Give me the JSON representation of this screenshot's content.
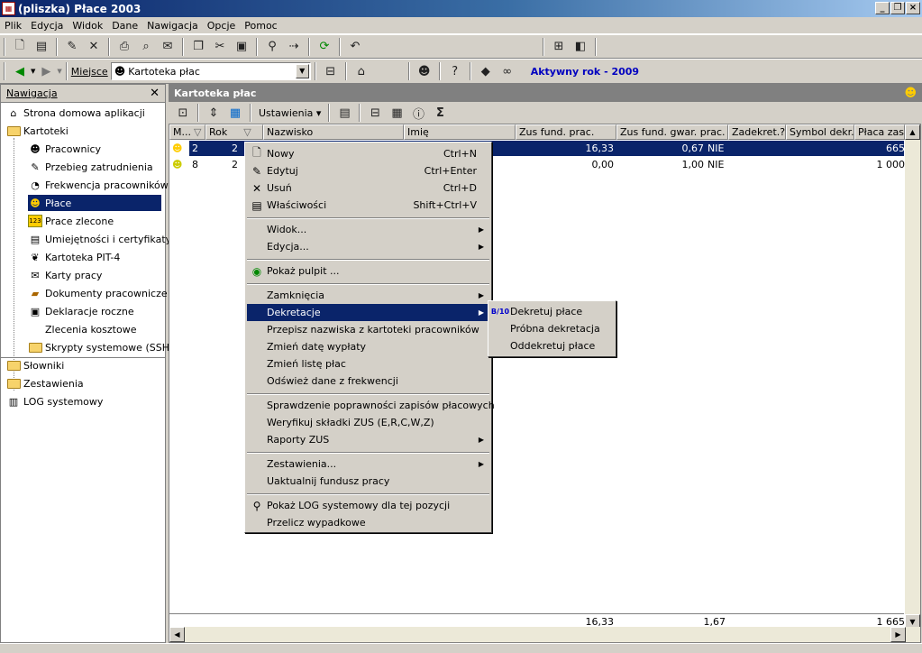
{
  "window": {
    "title": "(pliszka)  Płace 2003"
  },
  "menu": [
    "Plik",
    "Edycja",
    "Widok",
    "Dane",
    "Nawigacja",
    "Opcje",
    "Pomoc"
  ],
  "location": {
    "label": "Miejsce",
    "value": "Kartoteka płac",
    "active_year": "Aktywny rok - 2009"
  },
  "nav": {
    "title": "Nawigacja",
    "items": [
      {
        "label": "Strona domowa aplikacji",
        "icon": "home-icon"
      },
      {
        "label": "Kartoteki",
        "icon": "folder-open-icon"
      },
      {
        "label": "Pracownicy",
        "icon": "people-icon"
      },
      {
        "label": "Przebieg zatrudnienia",
        "icon": "history-icon"
      },
      {
        "label": "Frekwencja pracowników",
        "icon": "attendance-icon"
      },
      {
        "label": "Płace",
        "icon": "payroll-icon"
      },
      {
        "label": "Prace zlecone",
        "icon": "counter-icon"
      },
      {
        "label": "Umiejętności i certyfikaty",
        "icon": "certificate-icon"
      },
      {
        "label": "Kartoteka PIT-4",
        "icon": "tax-icon"
      },
      {
        "label": "Karty pracy",
        "icon": "card-icon"
      },
      {
        "label": "Dokumenty pracownicze",
        "icon": "documents-icon"
      },
      {
        "label": "Deklaracje roczne",
        "icon": "declaration-icon"
      },
      {
        "label": "Zlecenia kosztowe",
        "icon": ""
      },
      {
        "label": "Skrypty systemowe (SSH)",
        "icon": "folder-icon"
      },
      {
        "label": "Słowniki",
        "icon": "folder-icon"
      },
      {
        "label": "Zestawienia",
        "icon": "folder-icon"
      },
      {
        "label": "LOG systemowy",
        "icon": "log-icon"
      }
    ]
  },
  "main": {
    "title": "Kartoteka płac",
    "settings_label": "Ustawienia",
    "sigma": "Σ",
    "columns": [
      "M...",
      "Rok",
      "Nazwisko",
      "Imię",
      "Zus fund. prac.",
      "Zus fund. gwar. prac.",
      "Zadekret.?",
      "Symbol dekr...",
      "Płaca zasa"
    ],
    "rows": [
      {
        "m": "2",
        "rok": "2",
        "zus_prac": "16,33",
        "zus_gwar": "0,67",
        "zadekret": "NIE",
        "placa": "665"
      },
      {
        "m": "8",
        "rok": "2",
        "zus_prac": "0,00",
        "zus_gwar": "1,00",
        "zadekret": "NIE",
        "placa": "1 000"
      }
    ],
    "totals": {
      "zus_prac": "16,33",
      "zus_gwar": "1,67",
      "placa": "1 665"
    }
  },
  "context_menu": [
    {
      "label": "Nowy",
      "shortcut": "Ctrl+N",
      "icon": "new-icon"
    },
    {
      "label": "Edytuj",
      "shortcut": "Ctrl+Enter",
      "icon": "edit-icon"
    },
    {
      "label": "Usuń",
      "shortcut": "Ctrl+D",
      "icon": "delete-icon"
    },
    {
      "label": "Właściwości",
      "shortcut": "Shift+Ctrl+V",
      "icon": "properties-icon"
    },
    {
      "label": "Widok...",
      "submenu": true
    },
    {
      "label": "Edycja...",
      "submenu": true
    },
    {
      "label": "Pokaż pulpit ...",
      "icon": "desktop-icon"
    },
    {
      "label": "Zamknięcia",
      "submenu": true
    },
    {
      "label": "Dekretacje",
      "submenu": true
    },
    {
      "label": "Przepisz nazwiska z kartoteki pracowników"
    },
    {
      "label": "Zmień datę wypłaty"
    },
    {
      "label": "Zmień listę płac"
    },
    {
      "label": "Odśwież dane z frekwencji"
    },
    {
      "label": "Sprawdzenie poprawności zapisów płacowych"
    },
    {
      "label": "Weryfikuj składki ZUS (E,R,C,W,Z)"
    },
    {
      "label": "Raporty ZUS",
      "submenu": true
    },
    {
      "label": "Zestawienia...",
      "submenu": true
    },
    {
      "label": "Uaktualnij fundusz pracy"
    },
    {
      "label": "Pokaż LOG systemowy dla tej pozycji",
      "icon": "search-icon"
    },
    {
      "label": "Przelicz wypadkowe"
    }
  ],
  "submenu_dekretacje": [
    {
      "label": "Dekretuj płace",
      "icon": "decree-icon"
    },
    {
      "label": "Próbna dekretacja"
    },
    {
      "label": "Oddekretuj płace"
    }
  ]
}
